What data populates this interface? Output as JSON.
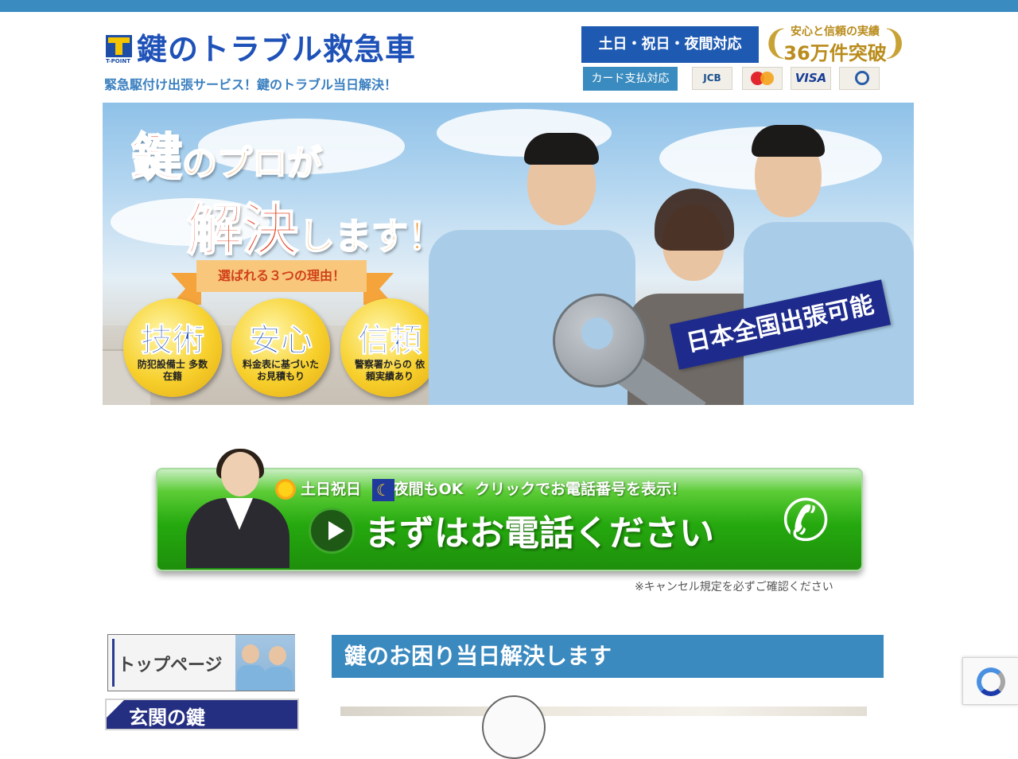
{
  "header": {
    "logo_badge": "T-POINT",
    "site_title": "鍵のトラブル救急車",
    "tagline": "緊急駆付け出張サービス！鍵のトラブル当日解決！",
    "hours_badge": "土日・祝日・夜間対応",
    "record_top": "安心と信頼の実績",
    "record_big": "36万件突破",
    "card_badge": "カード支払対応",
    "cards": [
      "JCB",
      "MasterCard",
      "VISA",
      "Diners Club"
    ]
  },
  "hero": {
    "headline_key": "鍵",
    "headline_rest": "のプロが",
    "headline2_big": "解決",
    "headline2_rest": "します！",
    "ribbon": "選ばれる３つの理由！",
    "medals": [
      {
        "title": "技術",
        "sub": "防犯設備士 多数在籍"
      },
      {
        "title": "安心",
        "sub": "料金表に基づいた お見積もり"
      },
      {
        "title": "信頼",
        "sub": "警察署からの 依頼実績あり"
      }
    ],
    "nationwide": "日本全国出張可能"
  },
  "call_banner": {
    "sub_day": "土日祝日",
    "sub_night": "夜間もOK",
    "sub_click": "クリックでお電話番号を表示！",
    "main": "まずはお電話ください",
    "note": "※キャンセル規定を必ずご確認ください"
  },
  "sidebar": {
    "top_page": "トップページ",
    "door_key": "玄関の鍵"
  },
  "main": {
    "section_title": "鍵のお困り当日解決します"
  },
  "colors": {
    "topbar": "#3a8bbf",
    "brand_blue": "#1f52b8",
    "call_green": "#25a90e",
    "navy": "#252f82"
  },
  "icons": {
    "logo": "t-point-logo-icon",
    "sun": "sun-icon",
    "moon": "moon-icon",
    "play": "play-icon",
    "phone": "phone-icon",
    "recaptcha": "recaptcha-icon"
  }
}
